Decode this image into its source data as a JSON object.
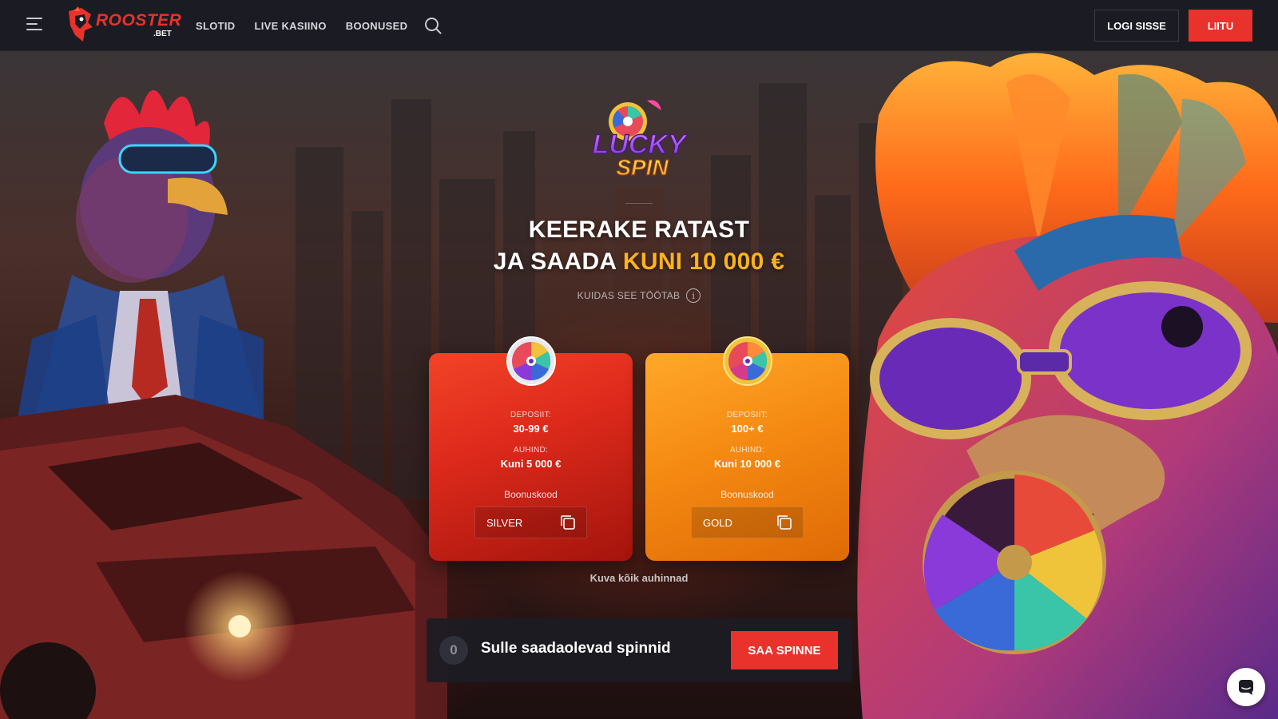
{
  "header": {
    "logo_text": "ROOSTER",
    "logo_suffix": ".BET",
    "nav": [
      "SLOTID",
      "LIVE KASIINO",
      "BOONUSED"
    ],
    "login_label": "LOGI SISSE",
    "join_label": "LIITU"
  },
  "promo": {
    "logo_line1": "LUCKY",
    "logo_line2": "SPIN",
    "headline_line1": "KEERAKE RATAST",
    "headline_line2_prefix": "JA SAADA",
    "headline_line2_highlight": "KUNI 10 000 €",
    "how_it_works": "KUIDAS SEE TÖÖTAB",
    "see_all_prizes": "Kuva kõik auhinnad"
  },
  "cards": [
    {
      "deposit_label": "DEPOSIIT:",
      "deposit_value": "30-99 €",
      "prize_label": "AUHIND:",
      "prize_value": "Kuni 5 000 €",
      "code_label": "Boonuskood",
      "code": "SILVER",
      "color": "#e3301f"
    },
    {
      "deposit_label": "DEPOSIIT:",
      "deposit_value": "100+ €",
      "prize_label": "AUHIND:",
      "prize_value": "Kuni 10 000 €",
      "code_label": "Boonuskood",
      "code": "GOLD",
      "color": "#f58a12"
    }
  ],
  "spins": {
    "count": "0",
    "label": "Sulle saadaolevad spinnid",
    "button": "SAA SPINNE"
  },
  "colors": {
    "accent": "#e8322b",
    "gold_text": "#ffb21e",
    "header_bg": "#1b1c23"
  },
  "icons": [
    "menu-icon",
    "search-icon",
    "info-icon",
    "copy-icon",
    "chat-icon"
  ]
}
